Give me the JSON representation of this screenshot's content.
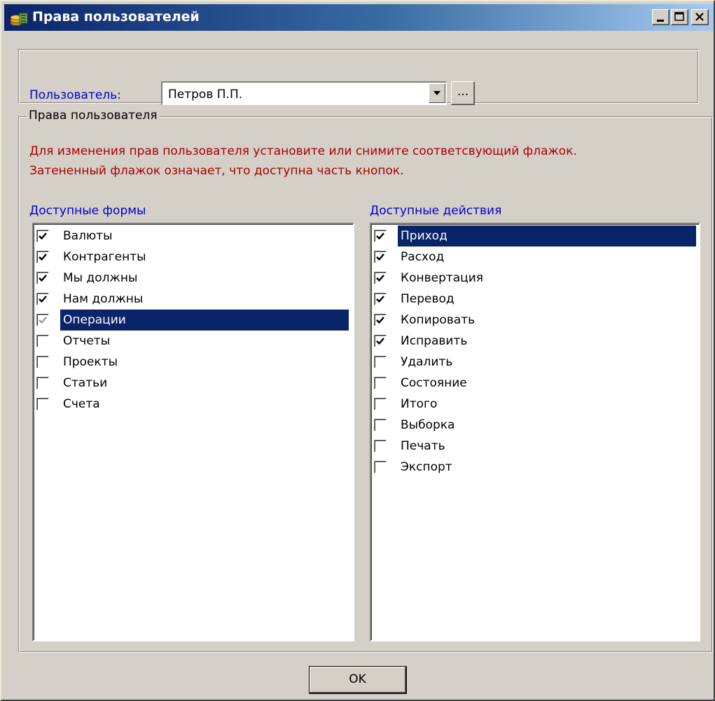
{
  "window": {
    "title": "Права пользователей",
    "buttons": [
      "minimize",
      "maximize",
      "close"
    ]
  },
  "user": {
    "label": "Пользователь:",
    "value": "Петров П.П.",
    "ellipsis": "..."
  },
  "rights": {
    "caption": "Права пользователя",
    "note_line1": "Для изменения прав пользователя установите или снимите соответсвующий флажок.",
    "note_line2": "Затененный флажок означает, что доступна часть кнопок."
  },
  "forms": {
    "label": "Доступные формы",
    "items": [
      {
        "label": "Валюты",
        "state": "checked"
      },
      {
        "label": "Контрагенты",
        "state": "checked"
      },
      {
        "label": "Мы должны",
        "state": "checked"
      },
      {
        "label": "Нам должны",
        "state": "checked"
      },
      {
        "label": "Операции",
        "state": "indeterminate",
        "selected": true
      },
      {
        "label": "Отчеты",
        "state": "unchecked"
      },
      {
        "label": "Проекты",
        "state": "unchecked"
      },
      {
        "label": "Статьи",
        "state": "unchecked"
      },
      {
        "label": "Счета",
        "state": "unchecked"
      }
    ]
  },
  "actions": {
    "label": "Доступные действия",
    "items": [
      {
        "label": "Приход",
        "state": "checked",
        "selected": true
      },
      {
        "label": "Расход",
        "state": "checked"
      },
      {
        "label": "Конвертация",
        "state": "checked"
      },
      {
        "label": "Перевод",
        "state": "checked"
      },
      {
        "label": "Копировать",
        "state": "checked"
      },
      {
        "label": "Исправить",
        "state": "checked"
      },
      {
        "label": "Удалить",
        "state": "unchecked"
      },
      {
        "label": "Состояние",
        "state": "unchecked"
      },
      {
        "label": "Итого",
        "state": "unchecked"
      },
      {
        "label": "Выборка",
        "state": "unchecked"
      },
      {
        "label": "Печать",
        "state": "unchecked"
      },
      {
        "label": "Экспорт",
        "state": "unchecked"
      }
    ]
  },
  "ok_label": "OK",
  "colors": {
    "face": "#d4d0c8",
    "title_start": "#0a246a",
    "selection": "#0a246a",
    "label_blue": "#0000cc",
    "note_red": "#aa0000"
  }
}
